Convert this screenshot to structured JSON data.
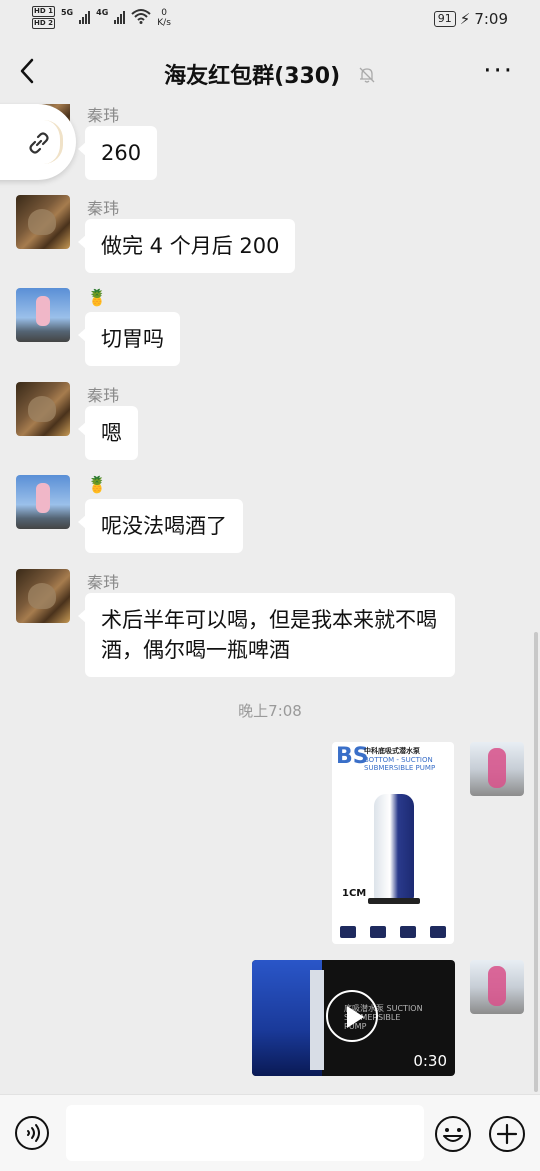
{
  "status_bar": {
    "sim1": "HD 1",
    "sim2": "HD 2",
    "net1": "5G",
    "net2": "4G",
    "speed_value": "0",
    "speed_unit": "K/s",
    "battery": "91",
    "time": "7:09"
  },
  "header": {
    "title": "海友红包群(330)",
    "back_icon": "chevron-left-icon",
    "mute_icon": "bell-muted-icon",
    "more_icon": "more-dots-icon"
  },
  "messages": [
    {
      "sender": "秦玮",
      "avatar": "cat",
      "text": "260"
    },
    {
      "sender": "秦玮",
      "avatar": "cat",
      "text": "做完 4 个月后 200"
    },
    {
      "sender": "🍍",
      "avatar": "sky",
      "text": "切胃吗"
    },
    {
      "sender": "秦玮",
      "avatar": "cat",
      "text": "嗯"
    },
    {
      "sender": "🍍",
      "avatar": "sky",
      "text": "呢没法喝酒了"
    },
    {
      "sender": "秦玮",
      "avatar": "cat",
      "text": "术后半年可以喝，但是我本来就不喝酒，偶尔喝一瓶啤酒"
    }
  ],
  "timestamp": "晚上7:08",
  "image_message": {
    "brand": "BS",
    "title_cn": "中科底吸式潜水泵",
    "title_en": "BOTTOM - SUCTION SUBMERSIBLE PUMP",
    "label": "1CM"
  },
  "video_message": {
    "duration": "0:30",
    "overlay_text": "底吸潜水泵 SUCTION SUBMERSIBLE PUMP"
  },
  "input_bar": {
    "voice_icon": "voice-icon",
    "emoji_icon": "emoji-icon",
    "plus_icon": "plus-icon",
    "placeholder": ""
  },
  "floating": {
    "icon": "link-icon"
  },
  "colors": {
    "bubble": "#ffffff",
    "background": "#ededed",
    "nickname": "#8a8a8a"
  }
}
